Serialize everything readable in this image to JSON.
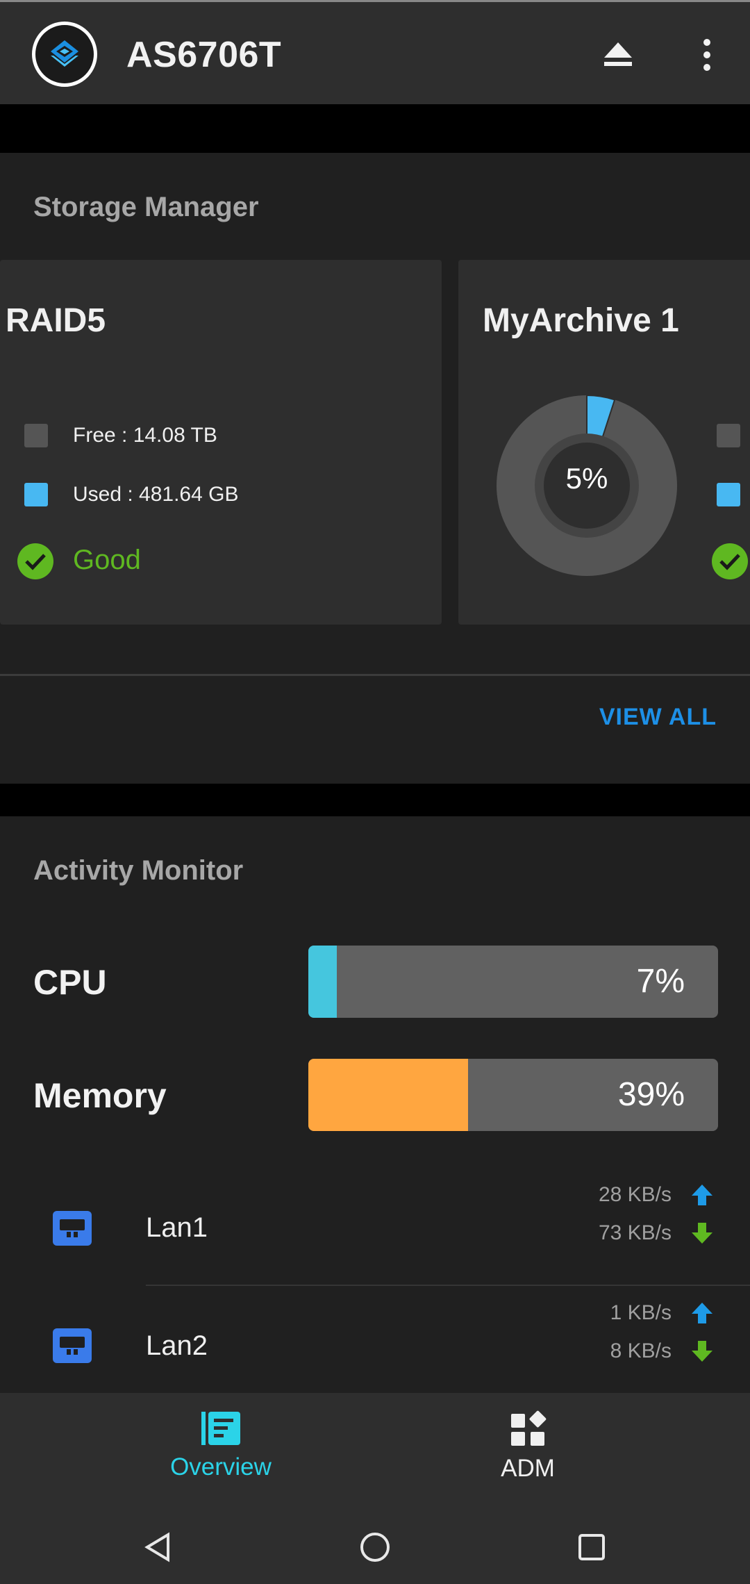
{
  "header": {
    "title": "AS6706T",
    "logo_icon": "asustor-logo-icon",
    "eject_icon": "eject-icon",
    "menu_icon": "more-vert-icon"
  },
  "storage": {
    "title": "Storage Manager",
    "view_all": "VIEW ALL",
    "volumes": [
      {
        "name": "RAID5",
        "free": "Free : 14.08 TB",
        "used": "Used : 481.64 GB",
        "status": "Good"
      },
      {
        "name": "MyArchive 1",
        "usage_label": "5%",
        "usage_fraction": 0.05
      }
    ],
    "colors": {
      "free": "#555555",
      "used": "#48b8f2",
      "good": "#5fb821"
    }
  },
  "activity": {
    "title": "Activity Monitor",
    "cpu": {
      "label": "CPU",
      "value": "7%",
      "fraction": 0.07,
      "color": "#45c6de"
    },
    "memory": {
      "label": "Memory",
      "value": "39%",
      "fraction": 0.39,
      "color": "#ffa640"
    },
    "lans": [
      {
        "name": "Lan1",
        "up": "28 KB/s",
        "down": "73 KB/s"
      },
      {
        "name": "Lan2",
        "up": "1 KB/s",
        "down": "8 KB/s"
      }
    ],
    "colors": {
      "up": "#1e9be8",
      "down": "#5fb821"
    }
  },
  "bottom_nav": {
    "items": [
      {
        "label": "Overview",
        "icon": "overview-icon",
        "active": true
      },
      {
        "label": "ADM",
        "icon": "apps-icon",
        "active": false
      }
    ],
    "accent": "#2bd3e8"
  },
  "system_nav": {
    "back": "back-icon",
    "home": "home-icon",
    "recents": "recents-icon"
  }
}
